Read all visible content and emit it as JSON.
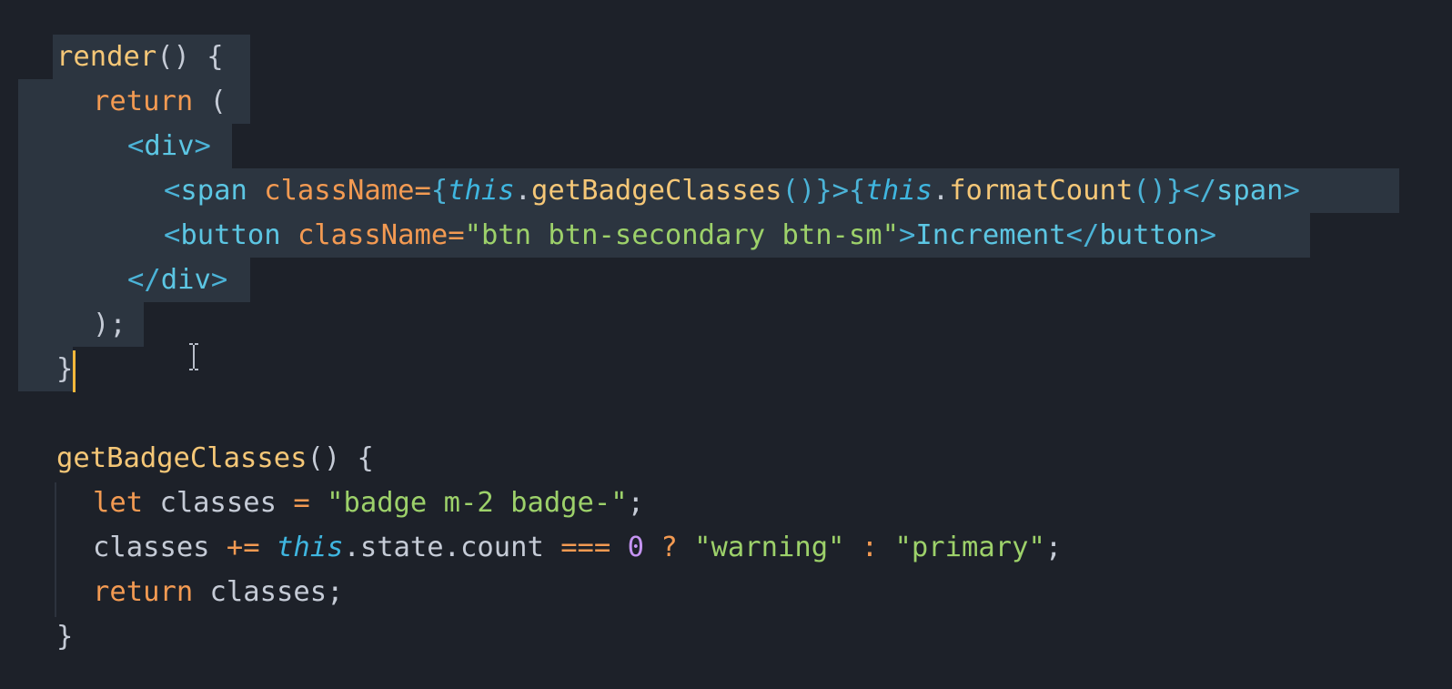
{
  "editor": {
    "colors": {
      "background": "#1d2129",
      "selection": "#2c3540",
      "keyword": "#f39a52",
      "function": "#f5c777",
      "tag": "#5cc6e3",
      "string": "#9dd16a",
      "this": "#3fb6e0",
      "number": "#c594f2",
      "cursor": "#f5b83b"
    },
    "icons": {
      "text_cursor": "i-beam-icon"
    },
    "code": {
      "l1": {
        "fn": "render",
        "rest": "() {"
      },
      "l2": {
        "kw": "return",
        "rest": " ("
      },
      "l3": {
        "open": "<",
        "tag": "div",
        "close": ">"
      },
      "l4": {
        "open": "<",
        "tag": "span",
        "sp": " ",
        "attr": "className=",
        "b1": "{",
        "this1": "this",
        "dot1": ".",
        "m1": "getBadgeClasses",
        "p1": "()",
        "b2": "}",
        "gt": ">",
        "b3": "{",
        "this2": "this",
        "dot2": ".",
        "m2": "formatCount",
        "p2": "()",
        "b4": "}",
        "close_open": "</",
        "close_tag": "span",
        "close_gt": ">"
      },
      "l5": {
        "open": "<",
        "tag": "button",
        "sp": " ",
        "attr": "className=",
        "str": "\"btn btn-secondary btn-sm\"",
        "gt": ">",
        "text": "Increment",
        "close_open": "</",
        "close_tag": "button",
        "close_gt": ">"
      },
      "l6": {
        "open": "</",
        "tag": "div",
        "close": ">"
      },
      "l7": {
        "text": ");"
      },
      "l8": {
        "text": "}"
      },
      "l9": {
        "fn": "getBadgeClasses",
        "rest": "() {"
      },
      "l10": {
        "kw": "let",
        "sp": " classes ",
        "op": "=",
        "sp2": " ",
        "str": "\"badge m-2 badge-\"",
        "semi": ";"
      },
      "l11": {
        "var": "classes ",
        "op": "+=",
        "sp": " ",
        "this": "this",
        "prop": ".state.count ",
        "eq": "===",
        "sp2": " ",
        "num": "0",
        "sp3": " ",
        "q": "?",
        "sp4": " ",
        "s1": "\"warning\"",
        "sp5": " ",
        "colon": ":",
        "sp6": " ",
        "s2": "\"primary\"",
        "semi": ";"
      },
      "l12": {
        "kw": "return",
        "rest": " classes;"
      },
      "l13": {
        "text": "}"
      }
    }
  }
}
